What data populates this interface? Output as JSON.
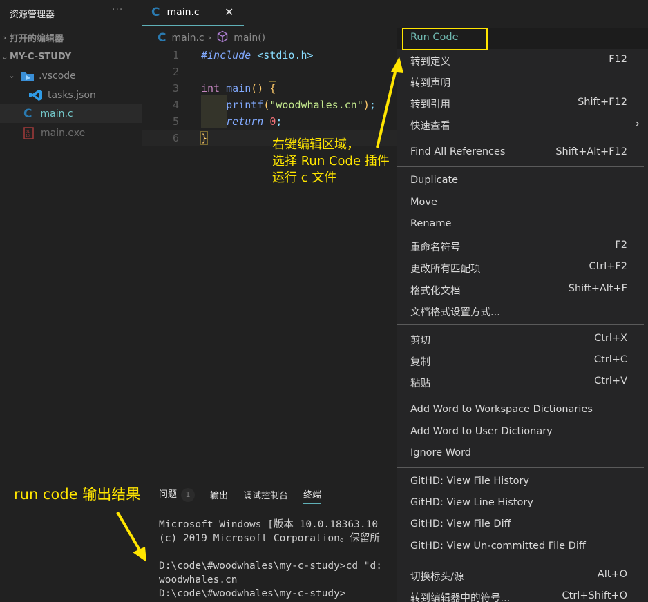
{
  "sidebar": {
    "title": "资源管理器",
    "more": "···",
    "open_editors": "打开的编辑器",
    "project": "MY-C-STUDY",
    "items": [
      {
        "label": ".vscode",
        "icon": "vscode-folder-icon"
      },
      {
        "label": "tasks.json",
        "icon": "vscode-icon"
      },
      {
        "label": "main.c",
        "icon": "c-file-icon"
      },
      {
        "label": "main.exe",
        "icon": "binary-file-icon"
      }
    ]
  },
  "tab": {
    "label": "main.c",
    "close": "✕"
  },
  "breadcrumb": {
    "file": "main.c",
    "sep": "›",
    "symbol": "main()"
  },
  "editor": {
    "line_numbers": [
      "1",
      "2",
      "3",
      "4",
      "5",
      "6"
    ],
    "lines": {
      "l1_kw": "#include",
      "l1_rest": " <stdio.h>",
      "l3_type": "int",
      "l3_fn": "main",
      "l3_paren": "()",
      "l3_brace": "{",
      "l4_fn": "printf",
      "l4_open": "(",
      "l4_str": "\"woodwhales.cn\"",
      "l4_close": ")",
      "l4_semi": ";",
      "l5_kw": "return",
      "l5_num": "0",
      "l5_semi": ";",
      "l6_brace": "}"
    }
  },
  "annotations": {
    "editor_note": "右键编辑区域，\n选择 Run Code 插件\n运行 c 文件",
    "output_note": "run code 输出结果",
    "color": "#ffe500"
  },
  "panel": {
    "tabs": [
      {
        "label": "问题",
        "badge": "1"
      },
      {
        "label": "输出"
      },
      {
        "label": "调试控制台"
      },
      {
        "label": "终端",
        "active": true
      }
    ],
    "terminal": "Microsoft Windows [版本 10.0.18363.10\n(c) 2019 Microsoft Corporation。保留所\n\nD:\\code\\#woodwhales\\my-c-study>cd \"d:\nwoodwhales.cn\nD:\\code\\#woodwhales\\my-c-study>"
  },
  "context_menu": {
    "items": [
      {
        "label": "Run Code",
        "key": ""
      },
      {
        "label": "转到定义",
        "key": "F12"
      },
      {
        "label": "转到声明",
        "key": ""
      },
      {
        "label": "转到引用",
        "key": "Shift+F12"
      },
      {
        "label": "快速查看",
        "key": "",
        "submenu": "›"
      },
      {
        "label": "Find All References",
        "key": "Shift+Alt+F12"
      },
      {
        "label": "Duplicate",
        "key": ""
      },
      {
        "label": "Move",
        "key": ""
      },
      {
        "label": "Rename",
        "key": ""
      },
      {
        "label": "重命名符号",
        "key": "F2"
      },
      {
        "label": "更改所有匹配项",
        "key": "Ctrl+F2"
      },
      {
        "label": "格式化文档",
        "key": "Shift+Alt+F"
      },
      {
        "label": "文档格式设置方式...",
        "key": ""
      },
      {
        "label": "剪切",
        "key": "Ctrl+X"
      },
      {
        "label": "复制",
        "key": "Ctrl+C"
      },
      {
        "label": "粘贴",
        "key": "Ctrl+V"
      },
      {
        "label": "Add Word to Workspace Dictionaries",
        "key": ""
      },
      {
        "label": "Add Word to User Dictionary",
        "key": ""
      },
      {
        "label": "Ignore Word",
        "key": ""
      },
      {
        "label": "GitHD: View File History",
        "key": ""
      },
      {
        "label": "GitHD: View Line History",
        "key": ""
      },
      {
        "label": "GitHD: View File Diff",
        "key": ""
      },
      {
        "label": "GitHD: View Un-committed File Diff",
        "key": ""
      },
      {
        "label": "切换标头/源",
        "key": "Alt+O"
      },
      {
        "label": "转到编辑器中的符号...",
        "key": "Ctrl+Shift+O"
      }
    ]
  }
}
